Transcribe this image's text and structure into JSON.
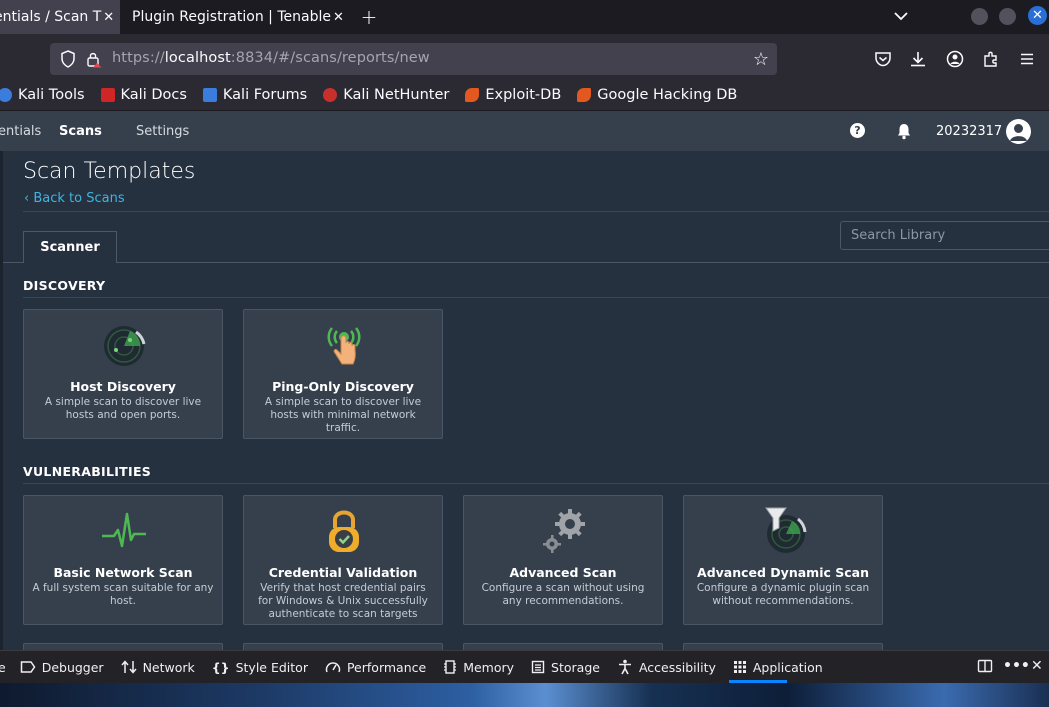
{
  "browser": {
    "tabs": [
      {
        "title": "entials / Scan T",
        "active": true
      },
      {
        "title": "Plugin Registration | Tenable",
        "active": false
      }
    ],
    "new_tab_label": "+",
    "url_prefix": "https://",
    "url_host": "localhost",
    "url_rest": ":8834/#/scans/reports/new",
    "bookmarks": [
      {
        "label": "Kali Tools",
        "icon": "kali-tools-icon",
        "color": "#3b7ddd"
      },
      {
        "label": "Kali Docs",
        "icon": "kali-docs-icon",
        "color": "#d02626"
      },
      {
        "label": "Kali Forums",
        "icon": "kali-forums-icon",
        "color": "#3b7ddd"
      },
      {
        "label": "Kali NetHunter",
        "icon": "kali-nethunter-icon",
        "color": "#c9302c"
      },
      {
        "label": "Exploit-DB",
        "icon": "exploit-db-icon",
        "color": "#e2581f"
      },
      {
        "label": "Google Hacking DB",
        "icon": "ghdb-icon",
        "color": "#e2581f"
      }
    ]
  },
  "app": {
    "nav": {
      "credentials": "entials",
      "scans": "Scans",
      "settings": "Settings"
    },
    "username": "20232317"
  },
  "page": {
    "title": "Scan Templates",
    "back_link": "Back to Scans",
    "search_placeholder": "Search Library",
    "tab_scanner": "Scanner",
    "sections": [
      {
        "title": "DISCOVERY",
        "cards": [
          {
            "title": "Host Discovery",
            "desc": "A simple scan to discover live hosts and open ports.",
            "icon": "radar-icon"
          },
          {
            "title": "Ping-Only Discovery",
            "desc": "A simple scan to discover live hosts with minimal network traffic.",
            "icon": "ping-hand-icon"
          }
        ]
      },
      {
        "title": "VULNERABILITIES",
        "cards": [
          {
            "title": "Basic Network Scan",
            "desc": "A full system scan suitable for any host.",
            "icon": "heartbeat-icon"
          },
          {
            "title": "Credential Validation",
            "desc": "Verify that host credential pairs for Windows & Unix successfully authenticate to scan targets",
            "icon": "padlock-icon"
          },
          {
            "title": "Advanced Scan",
            "desc": "Configure a scan without using any recommendations.",
            "icon": "gears-icon"
          },
          {
            "title": "Advanced Dynamic Scan",
            "desc": "Configure a dynamic plugin scan without recommendations.",
            "icon": "filter-radar-icon"
          }
        ]
      }
    ]
  },
  "devtools": {
    "tabs": [
      {
        "label": "e",
        "icon": "console-icon"
      },
      {
        "label": "Debugger",
        "icon": "debugger-icon"
      },
      {
        "label": "Network",
        "icon": "network-icon"
      },
      {
        "label": "Style Editor",
        "icon": "style-editor-icon"
      },
      {
        "label": "Performance",
        "icon": "performance-icon"
      },
      {
        "label": "Memory",
        "icon": "memory-icon"
      },
      {
        "label": "Storage",
        "icon": "storage-icon"
      },
      {
        "label": "Accessibility",
        "icon": "accessibility-icon"
      },
      {
        "label": "Application",
        "icon": "application-icon"
      }
    ],
    "active_tab": "Application"
  },
  "colors": {
    "accent_link": "#3fb4e0",
    "header_bg": "#36404d",
    "content_bg": "#263140",
    "card_bg": "#36404d",
    "devtools_active": "#0a84ff"
  }
}
